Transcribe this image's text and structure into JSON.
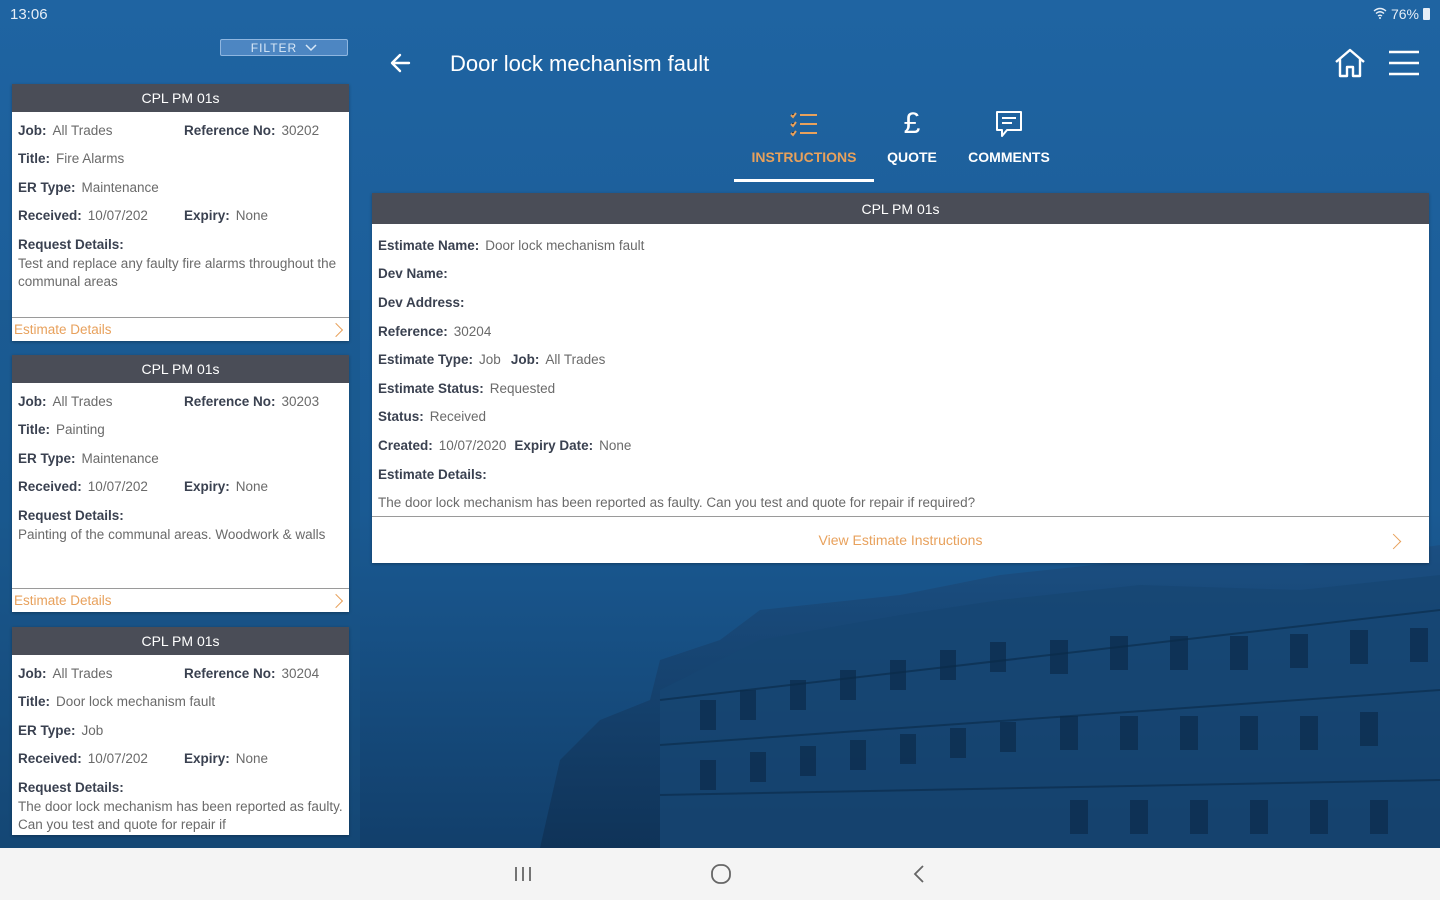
{
  "status_bar": {
    "time": "13:06",
    "battery": "76%"
  },
  "filter": {
    "label": "FILTER"
  },
  "cards": [
    {
      "header": "CPL PM 01s",
      "job_label": "Job:",
      "job": "All Trades",
      "ref_label": "Reference No:",
      "ref": "30202",
      "title_label": "Title:",
      "title": "Fire Alarms",
      "er_label": "ER Type:",
      "er_type": "Maintenance",
      "received_label": "Received:",
      "received": "10/07/202",
      "expiry_label": "Expiry:",
      "expiry": "None",
      "request_label": "Request Details:",
      "request": "Test and replace any faulty fire alarms throughout the communal areas",
      "footer": "Estimate Details"
    },
    {
      "header": "CPL PM 01s",
      "job_label": "Job:",
      "job": "All Trades",
      "ref_label": "Reference No:",
      "ref": "30203",
      "title_label": "Title:",
      "title": "Painting",
      "er_label": "ER Type:",
      "er_type": "Maintenance",
      "received_label": "Received:",
      "received": "10/07/202",
      "expiry_label": "Expiry:",
      "expiry": "None",
      "request_label": "Request Details:",
      "request": "Painting of the communal areas. Woodwork & walls",
      "footer": "Estimate Details"
    },
    {
      "header": "CPL PM 01s",
      "job_label": "Job:",
      "job": "All Trades",
      "ref_label": "Reference No:",
      "ref": "30204",
      "title_label": "Title:",
      "title": "Door lock mechanism fault",
      "er_label": "ER Type:",
      "er_type": "Job",
      "received_label": "Received:",
      "received": "10/07/202",
      "expiry_label": "Expiry:",
      "expiry": "None",
      "request_label": "Request Details:",
      "request": "The door lock mechanism has been reported as faulty. Can you test and quote for repair if",
      "footer": "Estimate Details"
    }
  ],
  "header": {
    "title": "Door lock mechanism fault"
  },
  "tabs": {
    "instructions": "INSTRUCTIONS",
    "quote": "QUOTE",
    "quote_icon": "£",
    "comments": "COMMENTS"
  },
  "detail": {
    "header": "CPL PM 01s",
    "estimate_name_label": "Estimate Name:",
    "estimate_name": "Door lock mechanism fault",
    "dev_name_label": "Dev Name:",
    "dev_address_label": "Dev Address:",
    "reference_label": "Reference:",
    "reference": "30204",
    "estimate_type_label": "Estimate Type:",
    "estimate_type": "Job",
    "job_label": "Job:",
    "job": "All Trades",
    "estimate_status_label": "Estimate Status:",
    "estimate_status": "Requested",
    "status_label": "Status:",
    "status": "Received",
    "created_label": "Created:",
    "created": "10/07/2020",
    "expiry_label": "Expiry Date:",
    "expiry": "None",
    "estimate_details_label": "Estimate Details:",
    "estimate_details": "The door lock mechanism has been reported as faulty. Can you test and quote for repair if required?",
    "footer": "View Estimate Instructions"
  },
  "icons": {
    "wifi": "wifi-icon",
    "battery": "battery-icon",
    "filter_chevron": "chevron-down-icon",
    "back": "arrow-left-icon",
    "home": "home-icon",
    "menu": "hamburger-menu-icon",
    "instructions": "list-icon",
    "quote": "pound-icon",
    "comments": "comment-icon"
  },
  "colors": {
    "background": "#1c5c96",
    "card_header": "#4a4d57",
    "accent_orange": "#e8a15c",
    "nav_bar": "#f4f4f4"
  }
}
